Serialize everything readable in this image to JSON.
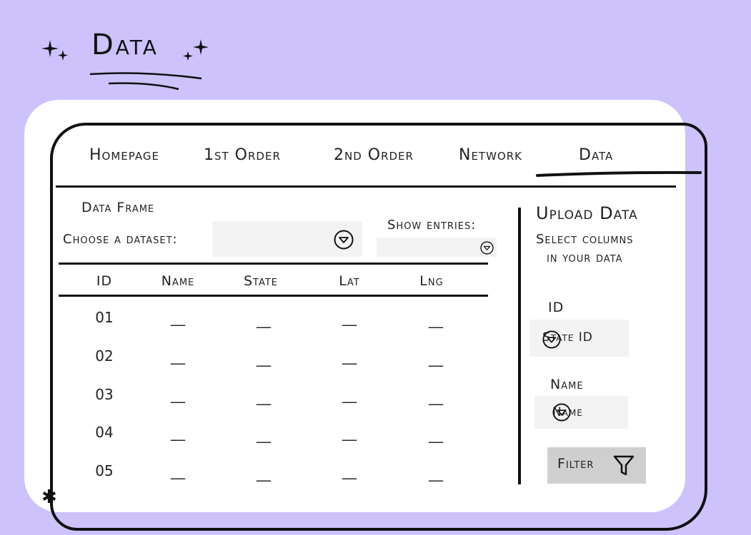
{
  "header": {
    "title": "Data"
  },
  "nav": {
    "items": [
      {
        "label": "Homepage"
      },
      {
        "label": "1st Order"
      },
      {
        "label": "2nd Order"
      },
      {
        "label": "Network"
      },
      {
        "label": "Data",
        "active": true
      }
    ]
  },
  "data_frame": {
    "title": "Data Frame",
    "choose_label": "Choose a dataset:",
    "dataset_value": "",
    "show_entries_label": "Show entries:",
    "entries_value": ""
  },
  "table": {
    "columns": [
      "ID",
      "Name",
      "State",
      "Lat",
      "Lng"
    ],
    "rows": [
      [
        "01",
        "__",
        "__",
        "__",
        "__"
      ],
      [
        "02",
        "__",
        "__",
        "__",
        "__"
      ],
      [
        "03",
        "__",
        "__",
        "__",
        "__"
      ],
      [
        "04",
        "__",
        "__",
        "__",
        "__"
      ],
      [
        "05",
        "__",
        "__",
        "__",
        "__"
      ]
    ]
  },
  "upload": {
    "title": "Upload Data",
    "subtitle_line1": "Select columns",
    "subtitle_line2": "in your data",
    "id_label": "ID",
    "id_value": "State ID",
    "name_label": "Name",
    "name_value": "Name",
    "filter_label": "Filter"
  },
  "colors": {
    "background": "#cdc2fc",
    "card": "#ffffff",
    "ink": "#111111",
    "field": "#f3f3f3",
    "button": "#cfcfcf"
  },
  "icons": [
    "sparkle-icon",
    "chevron-down-icon",
    "filter-funnel-icon",
    "asterisk-icon"
  ]
}
